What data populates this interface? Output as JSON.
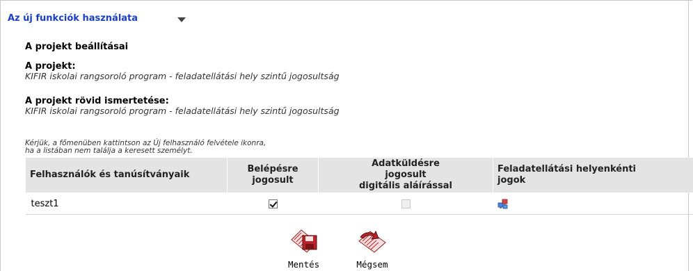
{
  "section": {
    "title": "Az új funkciók használata"
  },
  "settings": {
    "heading": "A projekt beállításai",
    "project_label": "A projekt:",
    "project_value": "KIFIR iskolai rangsoroló program - feladatellátási hely szintű jogosultság",
    "description_label": "A projekt rövid ismertetése:",
    "description_value": "KIFIR iskolai rangsoroló program - feladatellátási hely szintű jogosultság"
  },
  "hint": {
    "line1": "Kérjük, a főmenüben kattintson az Új felhasználó felvétele ikonra,",
    "line2": "ha a listában nem találja a keresett személyt."
  },
  "table": {
    "columns": [
      "Felhasználók és tanúsítványaik",
      "Belépésre jogosult",
      "Adatküldésre jogosult digitális aláírással",
      "Feladatellátási helyenkénti jogok"
    ],
    "col_lines": {
      "c1a": "Belépésre",
      "c1b": "jogosult",
      "c2a": "Adatküldésre",
      "c2b": "jogosult",
      "c2c": "digitális aláírással",
      "c3a": "Feladatellátási helyenkénti",
      "c3b": "jogok"
    },
    "rows": [
      {
        "user": "teszt1",
        "login_allowed": true,
        "signing_allowed": false,
        "signing_disabled": true
      }
    ]
  },
  "actions": {
    "save_label": "Mentés",
    "cancel_label": "Mégsem"
  },
  "colors": {
    "link": "#1a3fc4",
    "header_bg": "#e4e4e4",
    "icon_red": "#b8242a"
  }
}
